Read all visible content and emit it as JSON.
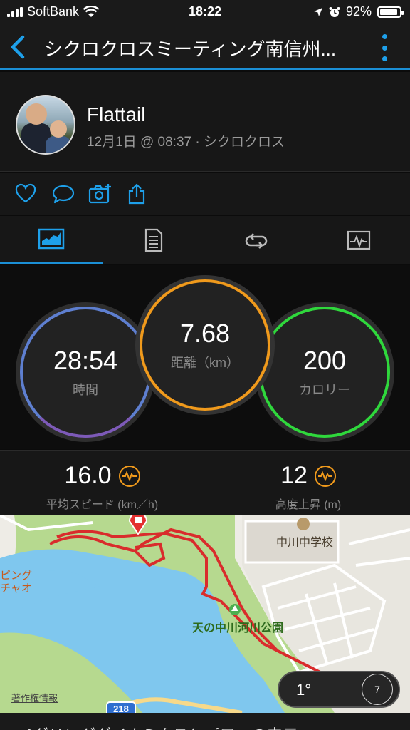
{
  "status_bar": {
    "carrier": "SoftBank",
    "time": "18:22",
    "battery": "92%",
    "battery_level": 0.92
  },
  "header": {
    "title": "シクロクロスミーティング南信州..."
  },
  "activity": {
    "user": "Flattail",
    "meta": "12月1日 @ 08:37 · シクロクロス"
  },
  "actions": [
    "like-icon",
    "comment-icon",
    "add-photo-icon",
    "share-icon"
  ],
  "tabs": [
    "overview-icon",
    "details-icon",
    "laps-icon",
    "chart-icon"
  ],
  "stats": {
    "time": {
      "value": "28:54",
      "label": "時間"
    },
    "distance": {
      "value": "7.68",
      "label": "距離（km）"
    },
    "calories": {
      "value": "200",
      "label": "カロリー"
    }
  },
  "metrics": {
    "avg_speed": {
      "value": "16.0",
      "label": "平均スピード (km／h)"
    },
    "elevation": {
      "value": "12",
      "label": "高度上昇 (m)"
    }
  },
  "map": {
    "school_label": "中川中学校",
    "park_label": "天の中川河川公園",
    "left_label_1": "ピング",
    "left_label_2": "チャオ",
    "route_shield": "218",
    "credit": "著作権情報",
    "temperature": "1°",
    "wind": "7"
  },
  "bottom_text": "ペダリングダイナミクスとパワーの表示",
  "colors": {
    "accent_blue": "#1b8fd6",
    "time_ring": "#5e7fd0",
    "distance_ring": "#f09a1c",
    "calorie_ring": "#2fd83c",
    "route": "#d92c2c"
  }
}
